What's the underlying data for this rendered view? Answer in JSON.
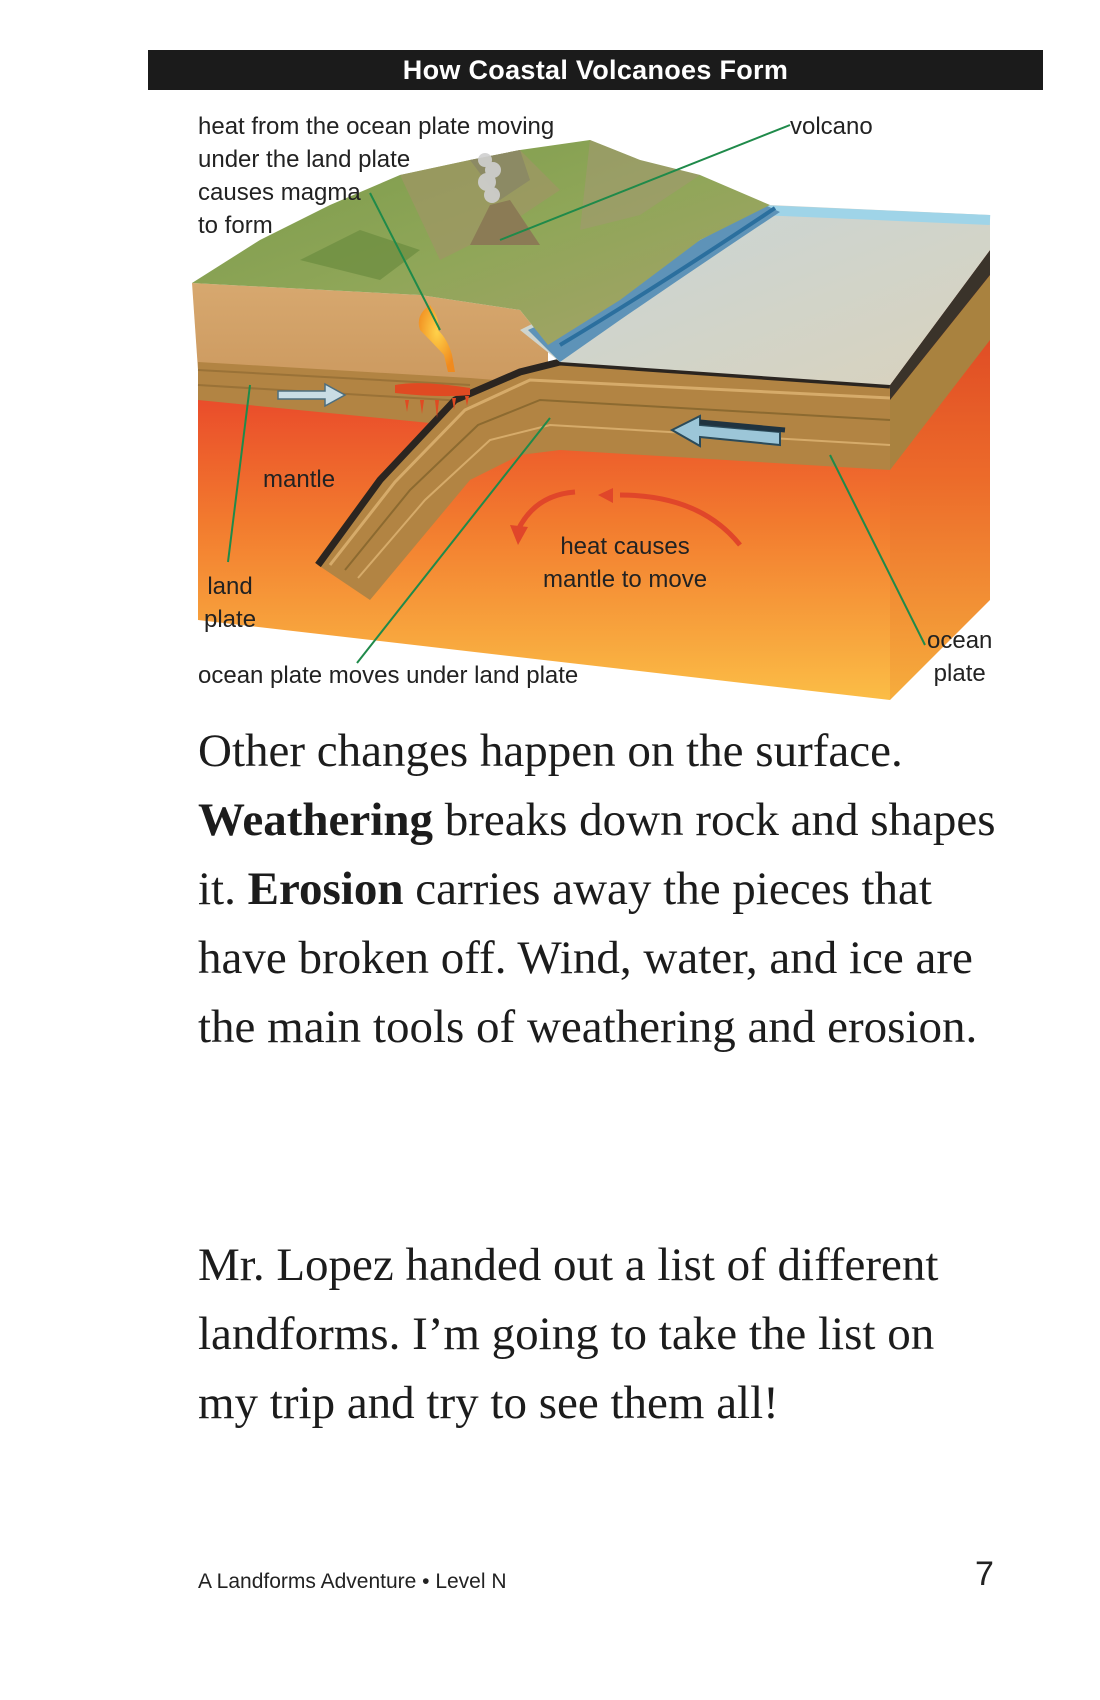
{
  "diagram": {
    "title": "How Coastal Volcanoes Form",
    "labels": {
      "heat": [
        "heat from the ocean plate moving",
        "under the land plate",
        "causes magma",
        "to form"
      ],
      "volcano": "volcano",
      "mantle": "mantle",
      "land_plate": [
        "land",
        "plate"
      ],
      "heat_mantle": [
        "heat causes",
        "mantle to move"
      ],
      "ocean_plate_moves": "ocean plate moves under land plate",
      "ocean_plate": [
        "ocean",
        "plate"
      ]
    }
  },
  "paragraphs": {
    "p1": {
      "t1": "Other changes happen on the surface. ",
      "b1": "Weathering",
      "t2": " breaks down rock and shapes it. ",
      "b2": "Erosion",
      "t3": " carries away the pieces that have broken off. Wind, water, and ice are the main tools of weathering and erosion."
    },
    "p2": "Mr. Lopez handed out a list of different landforms. I’m going to take the list on my trip and try to see them all!"
  },
  "footer": {
    "book": "A Landforms Adventure • Level N",
    "page": "7"
  }
}
